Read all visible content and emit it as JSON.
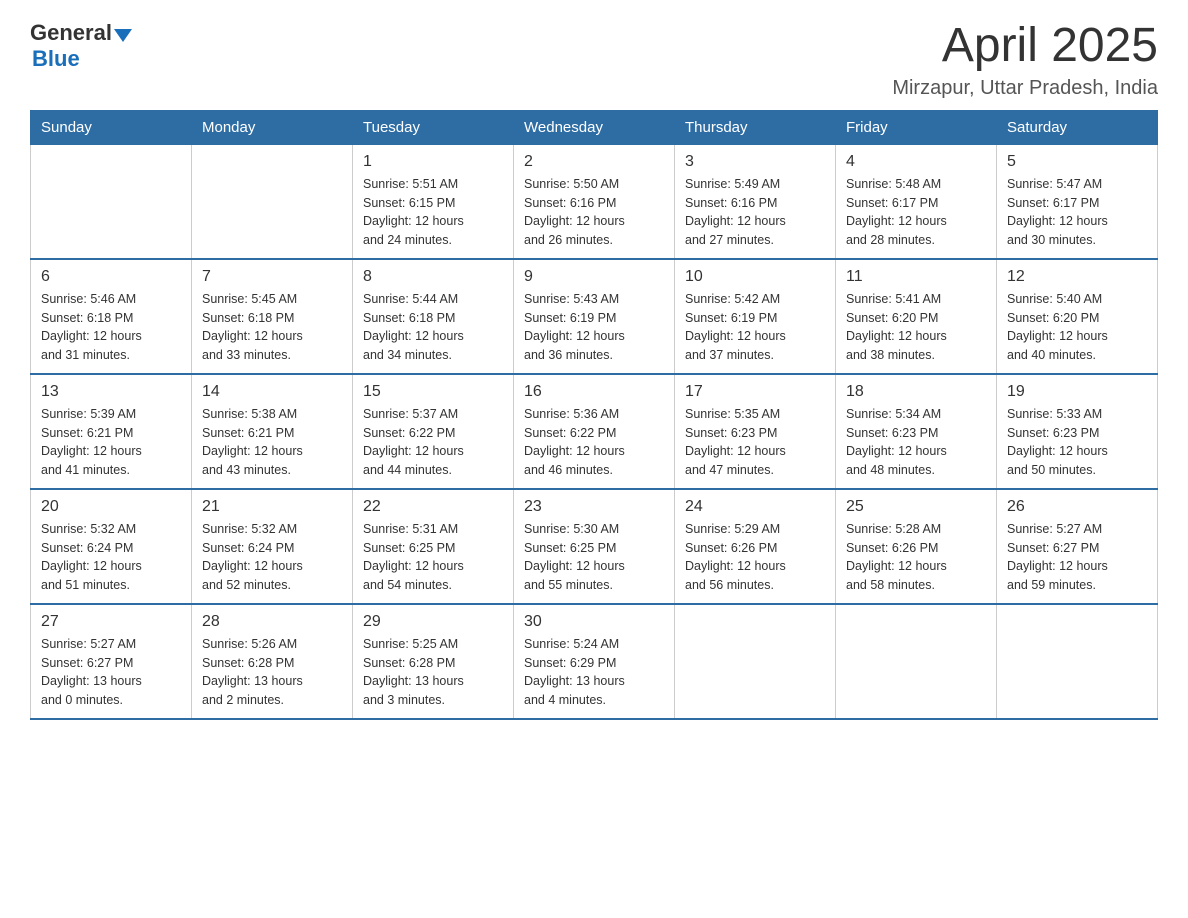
{
  "header": {
    "logo_general": "General",
    "logo_blue": "Blue",
    "title": "April 2025",
    "subtitle": "Mirzapur, Uttar Pradesh, India"
  },
  "days_of_week": [
    "Sunday",
    "Monday",
    "Tuesday",
    "Wednesday",
    "Thursday",
    "Friday",
    "Saturday"
  ],
  "weeks": [
    [
      {
        "day": "",
        "info": ""
      },
      {
        "day": "",
        "info": ""
      },
      {
        "day": "1",
        "info": "Sunrise: 5:51 AM\nSunset: 6:15 PM\nDaylight: 12 hours\nand 24 minutes."
      },
      {
        "day": "2",
        "info": "Sunrise: 5:50 AM\nSunset: 6:16 PM\nDaylight: 12 hours\nand 26 minutes."
      },
      {
        "day": "3",
        "info": "Sunrise: 5:49 AM\nSunset: 6:16 PM\nDaylight: 12 hours\nand 27 minutes."
      },
      {
        "day": "4",
        "info": "Sunrise: 5:48 AM\nSunset: 6:17 PM\nDaylight: 12 hours\nand 28 minutes."
      },
      {
        "day": "5",
        "info": "Sunrise: 5:47 AM\nSunset: 6:17 PM\nDaylight: 12 hours\nand 30 minutes."
      }
    ],
    [
      {
        "day": "6",
        "info": "Sunrise: 5:46 AM\nSunset: 6:18 PM\nDaylight: 12 hours\nand 31 minutes."
      },
      {
        "day": "7",
        "info": "Sunrise: 5:45 AM\nSunset: 6:18 PM\nDaylight: 12 hours\nand 33 minutes."
      },
      {
        "day": "8",
        "info": "Sunrise: 5:44 AM\nSunset: 6:18 PM\nDaylight: 12 hours\nand 34 minutes."
      },
      {
        "day": "9",
        "info": "Sunrise: 5:43 AM\nSunset: 6:19 PM\nDaylight: 12 hours\nand 36 minutes."
      },
      {
        "day": "10",
        "info": "Sunrise: 5:42 AM\nSunset: 6:19 PM\nDaylight: 12 hours\nand 37 minutes."
      },
      {
        "day": "11",
        "info": "Sunrise: 5:41 AM\nSunset: 6:20 PM\nDaylight: 12 hours\nand 38 minutes."
      },
      {
        "day": "12",
        "info": "Sunrise: 5:40 AM\nSunset: 6:20 PM\nDaylight: 12 hours\nand 40 minutes."
      }
    ],
    [
      {
        "day": "13",
        "info": "Sunrise: 5:39 AM\nSunset: 6:21 PM\nDaylight: 12 hours\nand 41 minutes."
      },
      {
        "day": "14",
        "info": "Sunrise: 5:38 AM\nSunset: 6:21 PM\nDaylight: 12 hours\nand 43 minutes."
      },
      {
        "day": "15",
        "info": "Sunrise: 5:37 AM\nSunset: 6:22 PM\nDaylight: 12 hours\nand 44 minutes."
      },
      {
        "day": "16",
        "info": "Sunrise: 5:36 AM\nSunset: 6:22 PM\nDaylight: 12 hours\nand 46 minutes."
      },
      {
        "day": "17",
        "info": "Sunrise: 5:35 AM\nSunset: 6:23 PM\nDaylight: 12 hours\nand 47 minutes."
      },
      {
        "day": "18",
        "info": "Sunrise: 5:34 AM\nSunset: 6:23 PM\nDaylight: 12 hours\nand 48 minutes."
      },
      {
        "day": "19",
        "info": "Sunrise: 5:33 AM\nSunset: 6:23 PM\nDaylight: 12 hours\nand 50 minutes."
      }
    ],
    [
      {
        "day": "20",
        "info": "Sunrise: 5:32 AM\nSunset: 6:24 PM\nDaylight: 12 hours\nand 51 minutes."
      },
      {
        "day": "21",
        "info": "Sunrise: 5:32 AM\nSunset: 6:24 PM\nDaylight: 12 hours\nand 52 minutes."
      },
      {
        "day": "22",
        "info": "Sunrise: 5:31 AM\nSunset: 6:25 PM\nDaylight: 12 hours\nand 54 minutes."
      },
      {
        "day": "23",
        "info": "Sunrise: 5:30 AM\nSunset: 6:25 PM\nDaylight: 12 hours\nand 55 minutes."
      },
      {
        "day": "24",
        "info": "Sunrise: 5:29 AM\nSunset: 6:26 PM\nDaylight: 12 hours\nand 56 minutes."
      },
      {
        "day": "25",
        "info": "Sunrise: 5:28 AM\nSunset: 6:26 PM\nDaylight: 12 hours\nand 58 minutes."
      },
      {
        "day": "26",
        "info": "Sunrise: 5:27 AM\nSunset: 6:27 PM\nDaylight: 12 hours\nand 59 minutes."
      }
    ],
    [
      {
        "day": "27",
        "info": "Sunrise: 5:27 AM\nSunset: 6:27 PM\nDaylight: 13 hours\nand 0 minutes."
      },
      {
        "day": "28",
        "info": "Sunrise: 5:26 AM\nSunset: 6:28 PM\nDaylight: 13 hours\nand 2 minutes."
      },
      {
        "day": "29",
        "info": "Sunrise: 5:25 AM\nSunset: 6:28 PM\nDaylight: 13 hours\nand 3 minutes."
      },
      {
        "day": "30",
        "info": "Sunrise: 5:24 AM\nSunset: 6:29 PM\nDaylight: 13 hours\nand 4 minutes."
      },
      {
        "day": "",
        "info": ""
      },
      {
        "day": "",
        "info": ""
      },
      {
        "day": "",
        "info": ""
      }
    ]
  ]
}
